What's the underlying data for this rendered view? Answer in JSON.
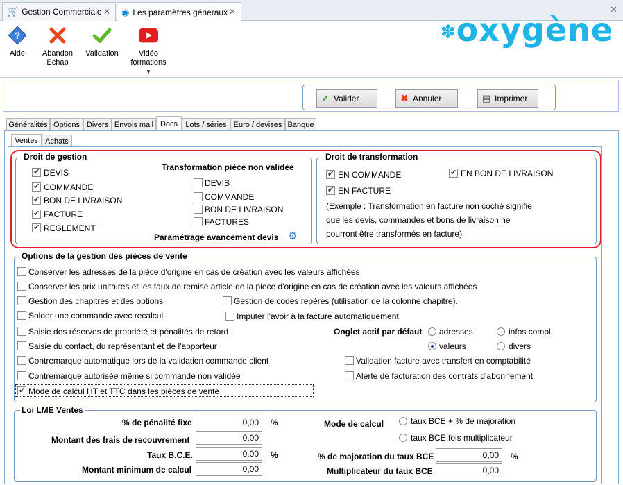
{
  "tabs": {
    "doc1": "Gestion Commerciale",
    "doc2": "Les paramètres généraux"
  },
  "ribbon": {
    "aide": "Aide",
    "abandon_1": "Abandon",
    "abandon_2": "Echap",
    "validation": "Validation",
    "video_1": "Vidéo",
    "video_2": "formations",
    "logo": "oxygène"
  },
  "actions": {
    "valider": "Valider",
    "annuler": "Annuler",
    "imprimer": "Imprimer"
  },
  "main_tabs": [
    "Généralités",
    "Options",
    "Divers",
    "Envois mail",
    "Docs",
    "Lots / séries",
    "Euro / devises",
    "Banque"
  ],
  "sub_tabs": [
    "Ventes",
    "Achats"
  ],
  "droit_gestion": {
    "title": "Droit de gestion",
    "items": [
      "DEVIS",
      "COMMANDE",
      "BON DE LIVRAISON",
      "FACTURE",
      "REGLEMENT"
    ],
    "transfo_title": "Transformation pièce non validée",
    "transfo_items": [
      "DEVIS",
      "COMMANDE",
      "BON DE LIVRAISON",
      "FACTURES"
    ],
    "param_label": "Paramétrage avancement devis"
  },
  "droit_transfo": {
    "title": "Droit de transformation",
    "en_commande": "EN COMMANDE",
    "en_bl": "EN BON DE LIVRAISON",
    "en_facture": "EN FACTURE",
    "note_1": "(Exemple : Transformation en facture non coché signifie",
    "note_2": "que les devis, commandes et bons de livraison ne",
    "note_3": "pourront être transformés en facture)"
  },
  "options": {
    "title": "Options de la gestion des pièces de vente",
    "o1": "Conserver les adresses de la pièce d'origine en cas de création avec les valeurs affichées",
    "o2": "Conserver les prix unitaires et les taux de remise article de la pièce d'origine en cas de création avec les valeurs affichées",
    "o3": "Gestion des chapitres et des options",
    "o4": "Gestion de codes repères (utilisation de la colonne chapitre).",
    "o5": "Solder une commande avec recalcul",
    "o6": "Imputer l'avoir à la facture automatiquement",
    "o7": "Saisie des réserves de propriété et pénalités de retard",
    "o8": "Saisie du contact, du représentant et de l'apporteur",
    "o9": "Contremarque automatique lors de la validation commande client",
    "o10": "Contremarque autorisée même si commande non validée",
    "o11": "Mode de calcul HT et TTC dans les pièces de vente",
    "o12": "Validation facture avec transfert en comptabilité",
    "o13": "Alerte de facturation des contrats d'abonnement",
    "onglet_label": "Onglet actif par défaut",
    "r_adresses": "adresses",
    "r_infos": "infos compl.",
    "r_valeurs": "valeurs",
    "r_divers": "divers"
  },
  "lme": {
    "title": "Loi LME Ventes",
    "penalite_label": "% de pénalité fixe",
    "penalite_value": "0,00",
    "frais_label": "Montant des frais de recouvrement",
    "frais_value": "0,00",
    "taux_bce_label": "Taux B.C.E.",
    "taux_bce_value": "0,00",
    "montant_min_label": "Montant minimum de calcul",
    "montant_min_value": "0,00",
    "pct": "%",
    "mode_label": "Mode de calcul",
    "mode_opt1": "taux BCE + % de majoration",
    "mode_opt2": "taux BCE fois multiplicateur",
    "majoration_label": "% de majoration du taux BCE",
    "majoration_value": "0,00",
    "multiplicateur_label": "Multiplicateur du taux BCE",
    "multiplicateur_value": "0,00"
  }
}
